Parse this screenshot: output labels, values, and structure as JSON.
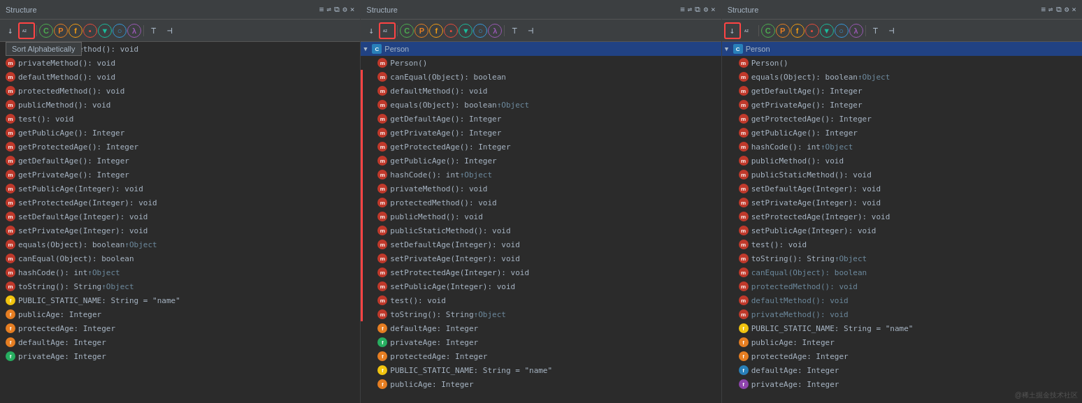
{
  "panels": [
    {
      "id": "panel1",
      "title": "Structure",
      "showTooltip": true,
      "tooltipText": "Sort Alphabetically",
      "highlightedBtn": 1,
      "treeItems": [
        {
          "type": "method",
          "icon": "m",
          "text": "publicStaticMethod(): void",
          "inherited": false
        },
        {
          "type": "method",
          "icon": "m",
          "text": "privateMethod(): void",
          "inherited": false
        },
        {
          "type": "method",
          "icon": "m",
          "text": "defaultMethod(): void",
          "inherited": false
        },
        {
          "type": "method",
          "icon": "m",
          "text": "protectedMethod(): void",
          "inherited": false
        },
        {
          "type": "method",
          "icon": "m",
          "text": "publicMethod(): void",
          "inherited": false
        },
        {
          "type": "method",
          "icon": "m",
          "text": "test(): void",
          "inherited": false
        },
        {
          "type": "method",
          "icon": "m",
          "text": "getPublicAge(): Integer",
          "inherited": false
        },
        {
          "type": "method",
          "icon": "m",
          "text": "getProtectedAge(): Integer",
          "inherited": false
        },
        {
          "type": "method",
          "icon": "m",
          "text": "getDefaultAge(): Integer",
          "inherited": false
        },
        {
          "type": "method",
          "icon": "m",
          "text": "getPrivateAge(): Integer",
          "inherited": false
        },
        {
          "type": "method",
          "icon": "m",
          "text": "setPublicAge(Integer): void",
          "inherited": false
        },
        {
          "type": "method",
          "icon": "m",
          "text": "setProtectedAge(Integer): void",
          "inherited": false
        },
        {
          "type": "method",
          "icon": "m",
          "text": "setDefaultAge(Integer): void",
          "inherited": false
        },
        {
          "type": "method",
          "icon": "m",
          "text": "setPrivateAge(Integer): void",
          "inherited": false
        },
        {
          "type": "method",
          "icon": "m",
          "text": "equals(Object): boolean ",
          "suffix": "↑Object",
          "inherited": false
        },
        {
          "type": "method",
          "icon": "m",
          "text": "canEqual(Object): boolean",
          "inherited": false
        },
        {
          "type": "method",
          "icon": "m",
          "text": "hashCode(): int ",
          "suffix": "↑Object",
          "inherited": false
        },
        {
          "type": "method",
          "icon": "m",
          "text": "toString(): String ",
          "suffix": "↑Object",
          "inherited": false
        },
        {
          "type": "field",
          "icon": "f",
          "color": "yellow",
          "text": "PUBLIC_STATIC_NAME: String = \"name\"",
          "inherited": false
        },
        {
          "type": "field",
          "icon": "f",
          "color": "orange",
          "text": "publicAge: Integer",
          "inherited": false
        },
        {
          "type": "field",
          "icon": "f",
          "color": "orange",
          "text": "protectedAge: Integer",
          "inherited": false
        },
        {
          "type": "field",
          "icon": "f",
          "color": "orange",
          "text": "defaultAge: Integer",
          "inherited": false
        },
        {
          "type": "field",
          "icon": "f",
          "color": "green",
          "text": "privateAge: Integer",
          "inherited": false
        }
      ]
    },
    {
      "id": "panel2",
      "title": "Structure",
      "highlightedBtn": 1,
      "classNode": {
        "name": "Person",
        "expanded": true
      },
      "treeItems": [
        {
          "type": "method",
          "icon": "m",
          "text": "Person()",
          "inherited": false
        },
        {
          "type": "method",
          "icon": "m",
          "text": "canEqual(Object): boolean",
          "inherited": false,
          "highlight": true
        },
        {
          "type": "method",
          "icon": "m",
          "text": "defaultMethod(): void",
          "inherited": false,
          "highlight": true
        },
        {
          "type": "method",
          "icon": "m",
          "text": "equals(Object): boolean ",
          "suffix": "↑Object",
          "inherited": false,
          "highlight": true
        },
        {
          "type": "method",
          "icon": "m",
          "text": "getDefaultAge(): Integer",
          "inherited": false,
          "highlight": true
        },
        {
          "type": "method",
          "icon": "m",
          "text": "getPrivateAge(): Integer",
          "inherited": false,
          "highlight": true
        },
        {
          "type": "method",
          "icon": "m",
          "text": "getProtectedAge(): Integer",
          "inherited": false,
          "highlight": true
        },
        {
          "type": "method",
          "icon": "m",
          "text": "getPublicAge(): Integer",
          "inherited": false,
          "highlight": true
        },
        {
          "type": "method",
          "icon": "m",
          "text": "hashCode(): int ",
          "suffix": "↑Object",
          "inherited": false,
          "highlight": true
        },
        {
          "type": "method",
          "icon": "m",
          "text": "privateMethod(): void",
          "inherited": false,
          "highlight": true
        },
        {
          "type": "method",
          "icon": "m",
          "text": "protectedMethod(): void",
          "inherited": false,
          "highlight": true
        },
        {
          "type": "method",
          "icon": "m",
          "text": "publicMethod(): void",
          "inherited": false,
          "highlight": true
        },
        {
          "type": "method",
          "icon": "m",
          "text": "publicStaticMethod(): void",
          "inherited": false,
          "highlight": true
        },
        {
          "type": "method",
          "icon": "m",
          "text": "setDefaultAge(Integer): void",
          "inherited": false,
          "highlight": true
        },
        {
          "type": "method",
          "icon": "m",
          "text": "setPrivateAge(Integer): void",
          "inherited": false,
          "highlight": true
        },
        {
          "type": "method",
          "icon": "m",
          "text": "setProtectedAge(Integer): void",
          "inherited": false,
          "highlight": true
        },
        {
          "type": "method",
          "icon": "m",
          "text": "setPublicAge(Integer): void",
          "inherited": false,
          "highlight": true
        },
        {
          "type": "method",
          "icon": "m",
          "text": "test(): void",
          "inherited": false,
          "highlight": true
        },
        {
          "type": "method",
          "icon": "m",
          "text": "toString(): String ",
          "suffix": "↑Object",
          "inherited": false,
          "highlight": true
        },
        {
          "type": "field",
          "icon": "f",
          "color": "orange",
          "text": "defaultAge: Integer",
          "inherited": false
        },
        {
          "type": "field",
          "icon": "f",
          "color": "green",
          "text": "privateAge: Integer",
          "inherited": false
        },
        {
          "type": "field",
          "icon": "f",
          "color": "orange",
          "text": "protectedAge: Integer",
          "inherited": false
        },
        {
          "type": "field",
          "icon": "f",
          "color": "yellow",
          "text": "PUBLIC_STATIC_NAME: String = \"name\"",
          "inherited": false
        },
        {
          "type": "field",
          "icon": "f",
          "color": "orange",
          "text": "publicAge: Integer",
          "inherited": false
        }
      ]
    },
    {
      "id": "panel3",
      "title": "Structure",
      "highlightedBtn": 0,
      "classNode": {
        "name": "Person",
        "expanded": true
      },
      "treeItems": [
        {
          "type": "method",
          "icon": "m",
          "text": "Person()",
          "inherited": false
        },
        {
          "type": "method",
          "icon": "m",
          "text": "equals(Object): boolean ",
          "suffix": "↑Object",
          "inherited": false
        },
        {
          "type": "method",
          "icon": "m",
          "text": "getDefaultAge(): Integer",
          "inherited": false
        },
        {
          "type": "method",
          "icon": "m",
          "text": "getPrivateAge(): Integer",
          "inherited": false
        },
        {
          "type": "method",
          "icon": "m",
          "text": "getProtectedAge(): Integer",
          "inherited": false
        },
        {
          "type": "method",
          "icon": "m",
          "text": "getPublicAge(): Integer",
          "inherited": false
        },
        {
          "type": "method",
          "icon": "m",
          "text": "hashCode(): int ",
          "suffix": "↑Object",
          "inherited": false
        },
        {
          "type": "method",
          "icon": "m",
          "text": "publicMethod(): void",
          "inherited": false
        },
        {
          "type": "method",
          "icon": "m",
          "text": "publicStaticMethod(): void",
          "inherited": false
        },
        {
          "type": "method",
          "icon": "m",
          "text": "setDefaultAge(Integer): void",
          "inherited": false
        },
        {
          "type": "method",
          "icon": "m",
          "text": "setPrivateAge(Integer): void",
          "inherited": false
        },
        {
          "type": "method",
          "icon": "m",
          "text": "setProtectedAge(Integer): void",
          "inherited": false
        },
        {
          "type": "method",
          "icon": "m",
          "text": "setPublicAge(Integer): void",
          "inherited": false
        },
        {
          "type": "method",
          "icon": "m",
          "text": "test(): void",
          "inherited": false
        },
        {
          "type": "method",
          "icon": "m",
          "text": "toString(): String ",
          "suffix": "↑Object",
          "inherited": false
        },
        {
          "type": "method",
          "icon": "m",
          "text": "canEqual(Object): boolean",
          "inherited": true
        },
        {
          "type": "method",
          "icon": "m",
          "text": "protectedMethod(): void",
          "inherited": true
        },
        {
          "type": "method",
          "icon": "m",
          "text": "defaultMethod(): void",
          "inherited": true
        },
        {
          "type": "method",
          "icon": "m",
          "text": "privateMethod(): void",
          "inherited": true
        },
        {
          "type": "field",
          "icon": "f",
          "color": "yellow",
          "text": "PUBLIC_STATIC_NAME: String = \"name\"",
          "inherited": false
        },
        {
          "type": "field",
          "icon": "f",
          "color": "orange",
          "text": "publicAge: Integer",
          "inherited": false
        },
        {
          "type": "field",
          "icon": "f",
          "color": "orange",
          "text": "protectedAge: Integer",
          "inherited": false
        },
        {
          "type": "field",
          "icon": "f",
          "color": "blue",
          "text": "defaultAge: Integer",
          "inherited": false
        },
        {
          "type": "field",
          "icon": "f",
          "color": "purple",
          "text": "privateAge: Integer",
          "inherited": false
        }
      ],
      "watermark": "@稀土掘金技术社区"
    }
  ],
  "toolbar": {
    "buttons": [
      {
        "id": "sort-down",
        "symbol": "↓↑",
        "tooltip": "Sort by Type"
      },
      {
        "id": "sort-alpha",
        "symbol": "az",
        "tooltip": "Sort Alphabetically"
      },
      {
        "id": "btn-c",
        "symbol": "C",
        "color": "green",
        "tooltip": "Show Classes"
      },
      {
        "id": "btn-p",
        "symbol": "P",
        "color": "orange",
        "tooltip": "Show Properties"
      },
      {
        "id": "btn-f",
        "symbol": "f",
        "color": "yellow",
        "tooltip": "Show Fields"
      },
      {
        "id": "btn-sq",
        "symbol": "▪",
        "color": "red",
        "tooltip": "Show Variables"
      },
      {
        "id": "btn-tri",
        "symbol": "▼",
        "color": "teal",
        "tooltip": "Show Interface"
      },
      {
        "id": "btn-o",
        "symbol": "○",
        "color": "blue",
        "tooltip": "Show Objects"
      },
      {
        "id": "btn-lambda",
        "symbol": "λ",
        "color": "purple",
        "tooltip": "Show Lambdas"
      },
      {
        "id": "btn-filter1",
        "symbol": "⊤",
        "color": "default",
        "tooltip": "Filter 1"
      },
      {
        "id": "btn-filter2",
        "symbol": "⊣",
        "color": "default",
        "tooltip": "Filter 2"
      }
    ]
  }
}
